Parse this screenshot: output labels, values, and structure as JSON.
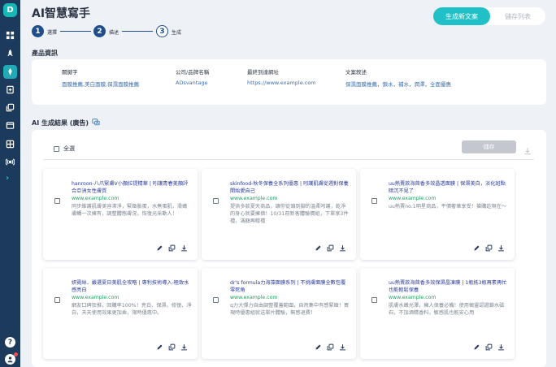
{
  "app": {
    "title": "AI智慧寫手",
    "logo_text": "D"
  },
  "header": {
    "generate_label": "生成新文案",
    "saved_list_label": "儲存列表"
  },
  "steps": [
    {
      "number": "1",
      "label": "選擇"
    },
    {
      "number": "2",
      "label": "描述"
    },
    {
      "number": "3",
      "label": "生成"
    }
  ],
  "product": {
    "section_title": "產品資訊",
    "fields": [
      {
        "label": "關鍵字",
        "value": "面膜推薦,美白面膜,保濕面膜推薦"
      },
      {
        "label": "公司/品牌名稱",
        "value": "ADsvantage"
      },
      {
        "label": "最終到達網址",
        "value": "https://www.example.com"
      },
      {
        "label": "文案敘述",
        "value": "保濕面膜推薦，鎖水，補水，潤澤，全面優惠"
      }
    ]
  },
  "results": {
    "section_title": "AI 生成結果 (廣告)",
    "select_all_label": "全選",
    "save_label": "儲存",
    "cards": [
      {
        "title": "hanroon-八爪緊膚V小顏拉提精華 | 吲護青春美顏評合亞洲女性膚質",
        "url": "www.example.com",
        "desc": "同步維護肌膚美容潔淨，緊緻臉蛋，水煮蛋肌，滑嫩膚觸一次擁有，調整體態膚況，恢復光采動人！"
      },
      {
        "title": "skinfood-秋冬保養全系列優惠 | 吲護肌膚從週對保養開始愛自己",
        "url": "www.example.com",
        "desc": "提供多款夏天商品，讓你從頭到腳的溫柔吲護，乾淨的身心就要擁擠！10/31前新客體驗價組，下單享3件禮，滿額再贈禮"
      },
      {
        "title": "uu熱賣款海茴香多效晶透面膜 | 保濕美白，淡化斑點暗沉不見了",
        "url": "www.example.com",
        "desc": "uu熱賣no.1明星商品，平價奢華享受！搶購趁現在～"
      },
      {
        "title": "妍霓絲．嚴選夏日美肌全攻略 | 專利技術導入-極致水感亮白",
        "url": "www.example.com",
        "desc": "網友口碑狂推，回購率100%！亮白、保濕、修復、淨白，天天使用效果更加乘，限時優惠中。"
      },
      {
        "title": "dr's formula力海藻面膜系列 | 不挑膚面膜全數包覆零死角",
        "url": "www.example.com",
        "desc": "q力大彈力自由調整覆蓋範圍，自然集中有感緊緻！買現時優惠組就送單片體驗，無感退費！"
      },
      {
        "title": "uu熱賣款海茴香多效保濕晶凍膜 | 1瓶抵3瓶再素再忙也能輕鬆保養",
        "url": "www.example.com",
        "desc": "肌膚水嫩光澤，擁人保養必備！使用徵靈認證鎖水磁石，不加酒精香料，敏感肌也能安心用"
      }
    ]
  },
  "colors": {
    "accent": "#1fc1c6",
    "step": "#1e4f8c",
    "sidebar": "#1c3a5c",
    "link_title": "#2a3a9a",
    "url": "#20a060"
  },
  "icons": [
    "dashboard-icon",
    "rocket-icon",
    "pen-icon",
    "document-edit-icon",
    "copy-stack-icon",
    "browser-window-icon",
    "grid-icon",
    "broadcast-icon",
    "chevron-right-icon",
    "help-icon",
    "user-icon",
    "edit-icon",
    "copy-icon",
    "download-icon",
    "translate-icon"
  ]
}
